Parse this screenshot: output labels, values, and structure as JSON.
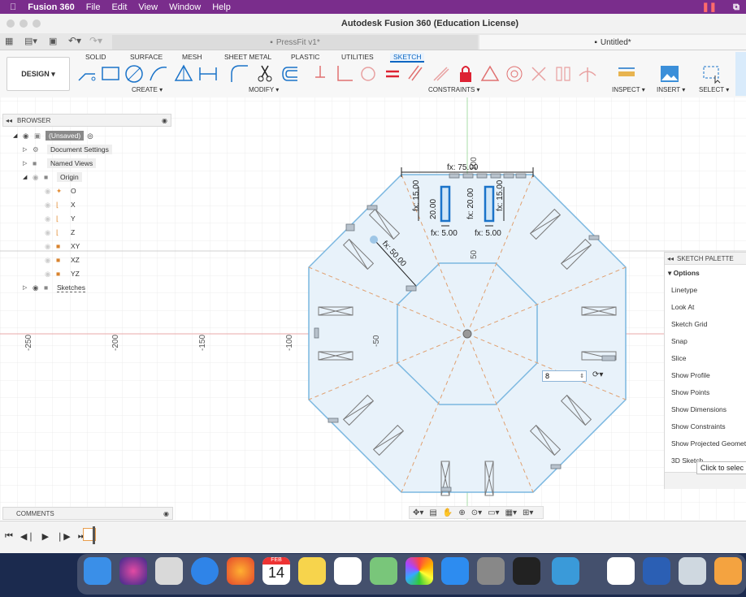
{
  "menubar": {
    "app": "Fusion 360",
    "items": [
      "File",
      "Edit",
      "View",
      "Window",
      "Help"
    ]
  },
  "window": {
    "title": "Autodesk Fusion 360 (Education License)"
  },
  "doc_tabs": [
    {
      "label": "PressFit v1*"
    },
    {
      "label": "Untitled*"
    }
  ],
  "ribbon": {
    "workspace": "DESIGN ▾",
    "tabs": [
      "SOLID",
      "SURFACE",
      "MESH",
      "SHEET METAL",
      "PLASTIC",
      "UTILITIES",
      "SKETCH"
    ],
    "active_tab": "SKETCH",
    "groups": [
      "CREATE ▾",
      "MODIFY ▾",
      "CONSTRAINTS ▾",
      "INSPECT ▾",
      "INSERT ▾",
      "SELECT ▾"
    ]
  },
  "browser": {
    "title": "BROWSER",
    "items": [
      {
        "label": "(Unsaved)"
      },
      {
        "label": "Document Settings"
      },
      {
        "label": "Named Views"
      },
      {
        "label": "Origin"
      },
      {
        "label": "O"
      },
      {
        "label": "X"
      },
      {
        "label": "Y"
      },
      {
        "label": "Z"
      },
      {
        "label": "XY"
      },
      {
        "label": "XZ"
      },
      {
        "label": "YZ"
      },
      {
        "label": "Sketches"
      }
    ]
  },
  "canvas": {
    "axis_labels": [
      "-250",
      "-200",
      "-150",
      "-100",
      "-50",
      "100",
      "50"
    ],
    "dimensions": {
      "top": "fx: 75.00",
      "diag": "fx: 50.00",
      "w1": "fx: 5.00",
      "w2": "fx: 5.00",
      "h1": "fx: 15.00",
      "h2": "20.00",
      "h3": "fx: 20.00",
      "h4": "fx: 15.00"
    },
    "input_value": "8",
    "tooltip": "Click to selec"
  },
  "palette": {
    "title": "SKETCH PALETTE",
    "section": "Options",
    "items": [
      "Linetype",
      "Look At",
      "Sketch Grid",
      "Snap",
      "Slice",
      "Show Profile",
      "Show Points",
      "Show Dimensions",
      "Show Constraints",
      "Show Projected Geometries",
      "3D Sketch"
    ]
  },
  "comments": {
    "title": "COMMENTS"
  },
  "dock": {
    "calendar_month": "FEB",
    "calendar_day": "14"
  }
}
